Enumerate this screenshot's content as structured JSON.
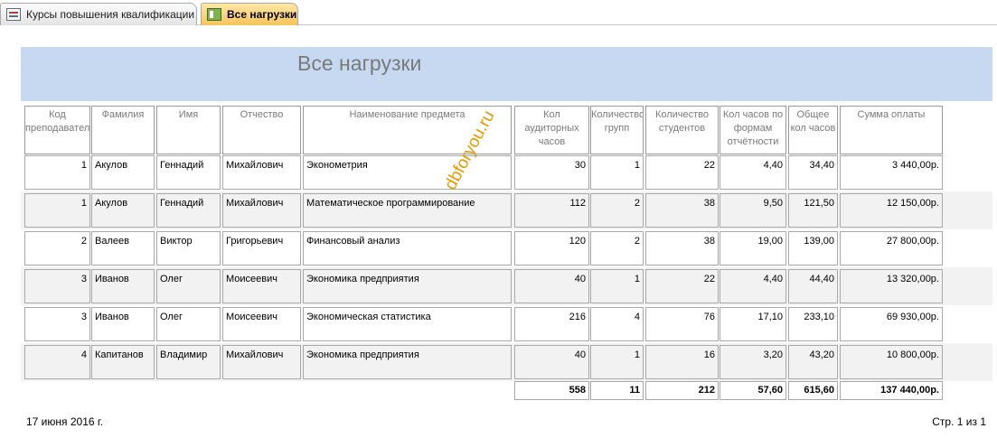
{
  "tabs": [
    {
      "label": "Курсы повышения квалификации",
      "active": false
    },
    {
      "label": "Все нагрузки",
      "active": true
    }
  ],
  "report": {
    "title": "Все нагрузки",
    "watermark": "dbforyou.ru",
    "columns": [
      "Код преподавателя",
      "Фамилия",
      "Имя",
      "Отчество",
      "Наименование предмета",
      "Кол аудиторных часов",
      "Количество групп",
      "Количество студентов",
      "Кол часов по формам отчётности",
      "Общее кол часов",
      "Сумма оплаты"
    ],
    "rows": [
      [
        "1",
        "Акулов",
        "Геннадий",
        "Михайлович",
        "Эконометрия",
        "30",
        "1",
        "22",
        "4,40",
        "34,40",
        "3 440,00р."
      ],
      [
        "1",
        "Акулов",
        "Геннадий",
        "Михайлович",
        "Математическое программирование",
        "112",
        "2",
        "38",
        "9,50",
        "121,50",
        "12 150,00р."
      ],
      [
        "2",
        "Валеев",
        "Виктор",
        "Григорьевич",
        "Финансовый анализ",
        "120",
        "2",
        "38",
        "19,00",
        "139,00",
        "27 800,00р."
      ],
      [
        "3",
        "Иванов",
        "Олег",
        "Моисеевич",
        "Экономика предприятия",
        "40",
        "1",
        "22",
        "4,40",
        "44,40",
        "13 320,00р."
      ],
      [
        "3",
        "Иванов",
        "Олег",
        "Моисеевич",
        "Экономическая статистика",
        "216",
        "4",
        "76",
        "17,10",
        "233,10",
        "69 930,00р."
      ],
      [
        "4",
        "Капитанов",
        "Владимир",
        "Михайлович",
        "Экономика предприятия",
        "40",
        "1",
        "16",
        "3,20",
        "43,20",
        "10 800,00р."
      ]
    ],
    "totals": [
      "558",
      "11",
      "212",
      "57,60",
      "615,60",
      "137 440,00р."
    ]
  },
  "footer": {
    "date": "17 июня 2016 г.",
    "page": "Стр. 1 из 1"
  },
  "colors": {
    "header_band": "#c6d9f1",
    "active_tab": "#f8c45a",
    "alt_row": "#f2f2f2",
    "watermark": "#e69a00"
  }
}
